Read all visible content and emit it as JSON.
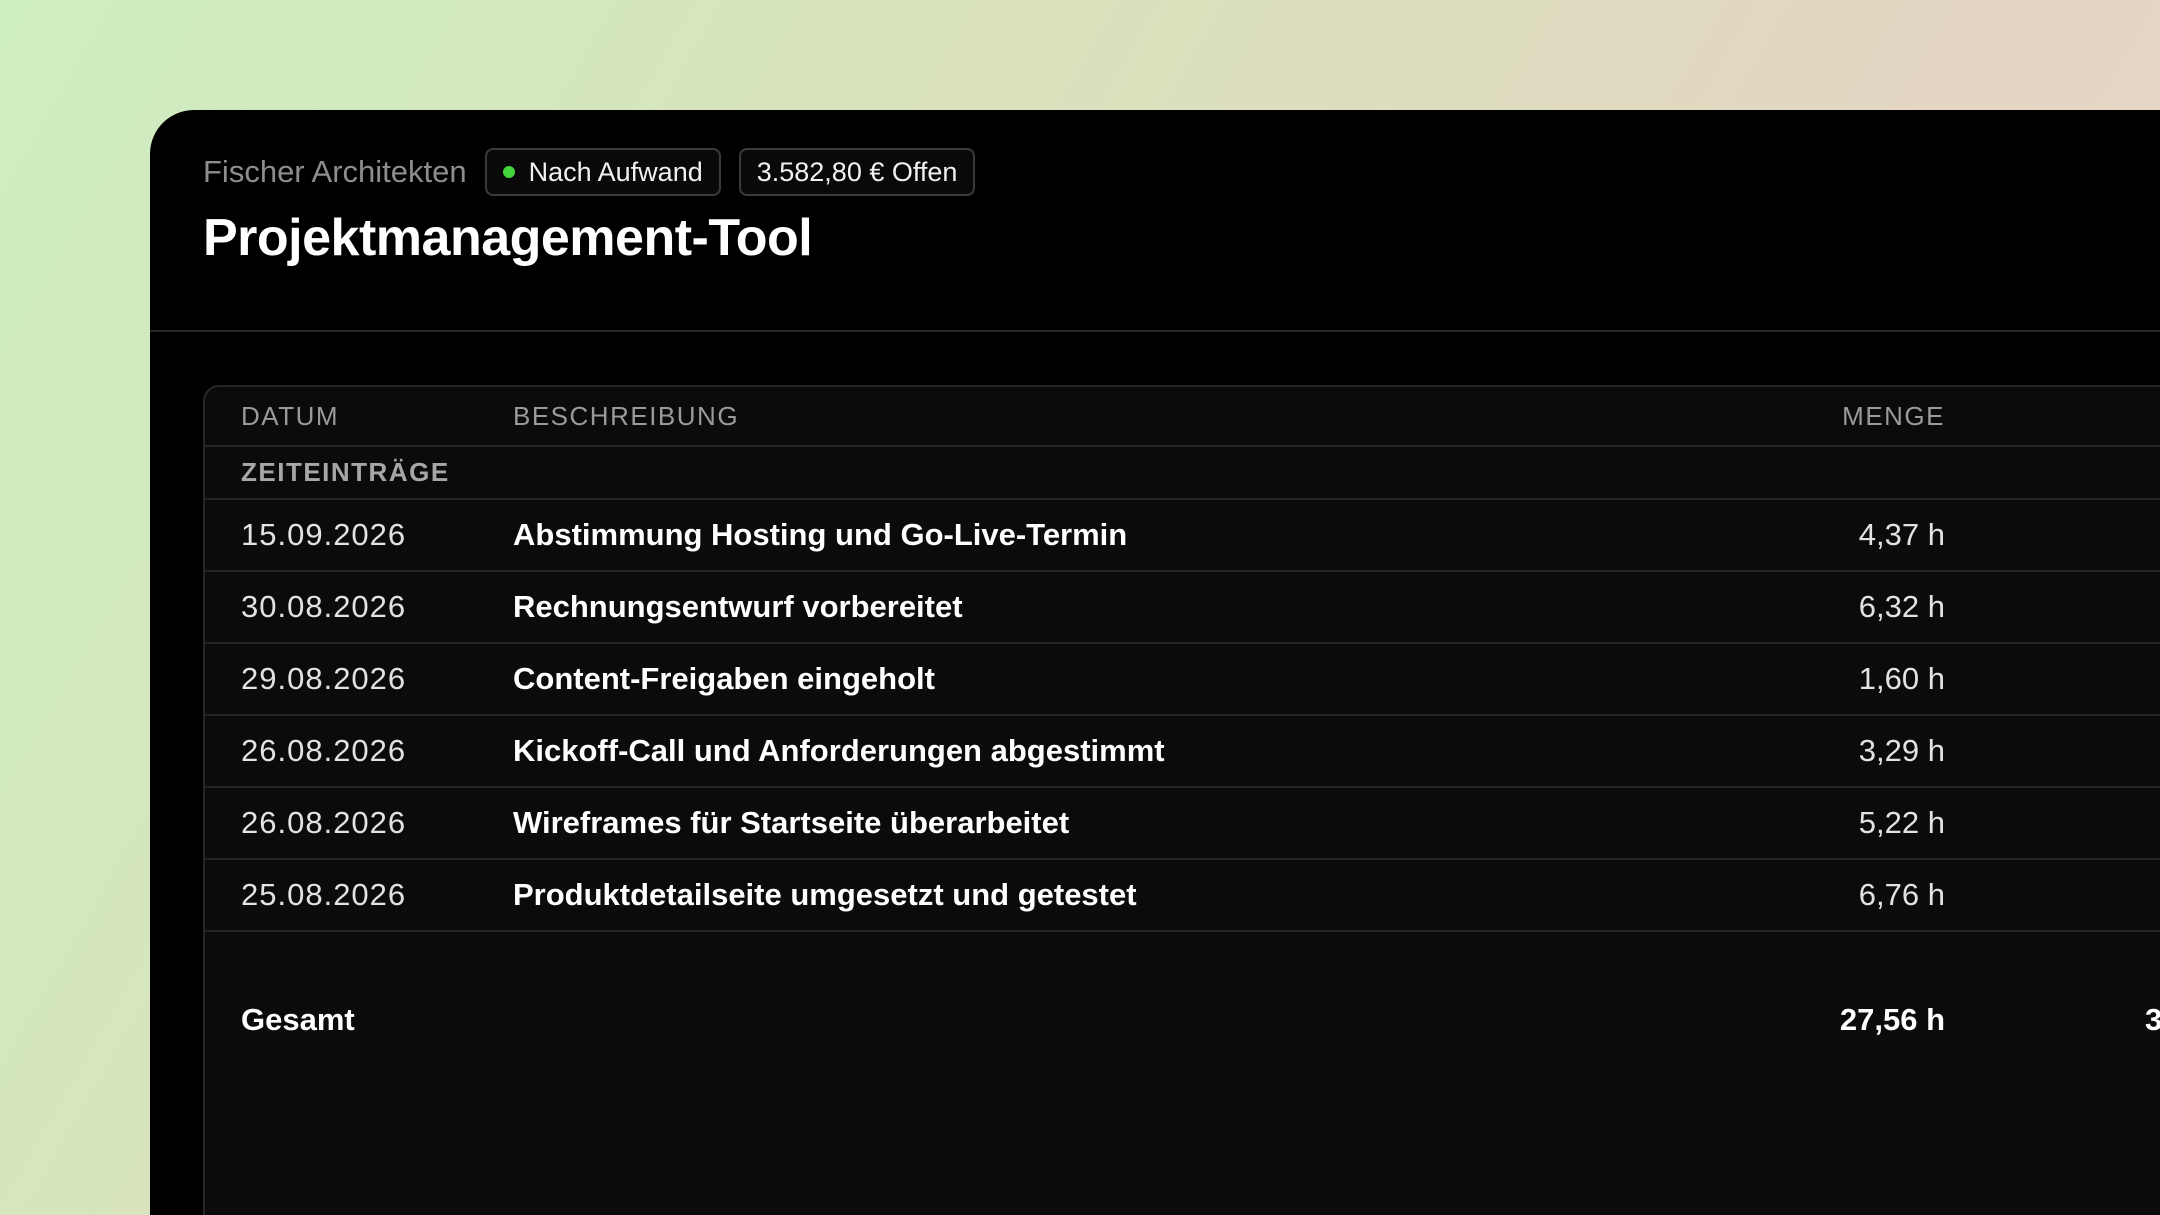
{
  "project": {
    "client": "Fischer Architekten",
    "billing_badge": "Nach Aufwand",
    "open_amount": "3.582,80 € Offen",
    "title": "Projektmanagement-Tool"
  },
  "table": {
    "columns": {
      "date": "DATUM",
      "description": "BESCHREIBUNG",
      "quantity": "MENGE"
    },
    "group_label": "ZEITEINTRÄGE",
    "rows": [
      {
        "date": "15.09.2026",
        "description": "Abstimmung Hosting und Go-Live-Termin",
        "quantity": "4,37 h"
      },
      {
        "date": "30.08.2026",
        "description": "Rechnungsentwurf vorbereitet",
        "quantity": "6,32 h"
      },
      {
        "date": "29.08.2026",
        "description": "Content-Freigaben eingeholt",
        "quantity": "1,60 h"
      },
      {
        "date": "26.08.2026",
        "description": "Kickoff-Call und Anforderungen abgestimmt",
        "quantity": "3,29 h"
      },
      {
        "date": "26.08.2026",
        "description": "Wireframes für Startseite überarbeitet",
        "quantity": "5,22 h"
      },
      {
        "date": "25.08.2026",
        "description": "Produktdetailseite umgesetzt und getestet",
        "quantity": "6,76 h"
      }
    ],
    "total": {
      "label": "Gesamt",
      "quantity": "27,56 h",
      "truncated_amount": "3"
    }
  },
  "colors": {
    "status_dot": "#44d43b",
    "background": "#000000"
  }
}
